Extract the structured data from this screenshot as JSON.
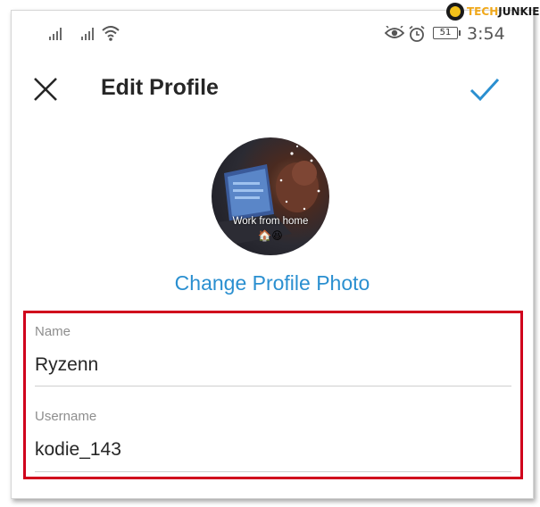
{
  "watermark": {
    "part1": "TECH",
    "part2": "JUNKIE"
  },
  "status_bar": {
    "time": "3:54",
    "battery": "51",
    "icons": [
      "signal-icon",
      "signal-icon",
      "wifi-icon",
      "eye-icon",
      "alarm-icon",
      "battery-icon"
    ]
  },
  "header": {
    "title": "Edit Profile",
    "close_icon": "close-icon",
    "confirm_icon": "checkmark-icon",
    "accent": "#2a8fd0"
  },
  "profile": {
    "photo_caption": "Work from home",
    "photo_emoji": "🏠😆",
    "change_photo_label": "Change Profile Photo"
  },
  "fields": [
    {
      "label": "Name",
      "value": "Ryzenn"
    },
    {
      "label": "Username",
      "value": "kodie_143"
    }
  ],
  "highlight_color": "#d0001c"
}
